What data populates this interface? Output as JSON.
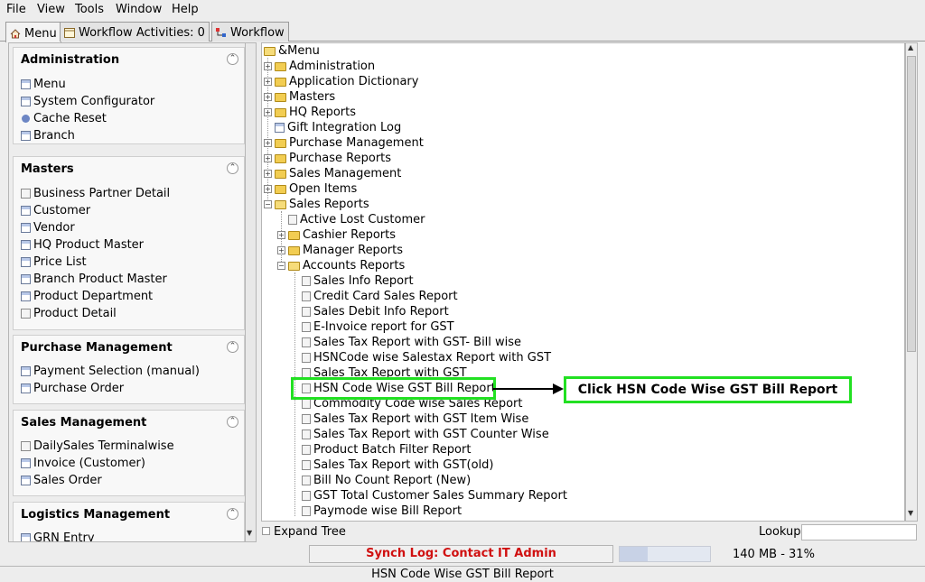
{
  "menubar": {
    "file": "File",
    "view": "View",
    "tools": "Tools",
    "window": "Window",
    "help": "Help"
  },
  "tabs": [
    {
      "label": "Menu",
      "icon": "home-icon"
    },
    {
      "label": "Workflow Activities: 0",
      "icon": "calendar-icon"
    },
    {
      "label": "Workflow",
      "icon": "workflow-icon"
    }
  ],
  "sidebar": {
    "administration": {
      "title": "Administration",
      "items": [
        "Menu",
        "System Configurator",
        "Cache Reset",
        "Branch"
      ]
    },
    "masters": {
      "title": "Masters",
      "items": [
        "Business Partner Detail",
        "Customer",
        "Vendor",
        "HQ Product Master",
        "Price List",
        "Branch Product Master",
        "Product Department",
        "Product Detail"
      ]
    },
    "purchase": {
      "title": "Purchase Management",
      "items": [
        "Payment Selection (manual)",
        "Purchase Order"
      ]
    },
    "sales": {
      "title": "Sales Management",
      "items": [
        "DailySales Terminalwise",
        "Invoice (Customer)",
        "Sales Order"
      ]
    },
    "logistics": {
      "title": "Logistics Management",
      "items": [
        "GRN Entry"
      ]
    }
  },
  "tree": {
    "root": "&Menu",
    "top": [
      "Administration",
      "Application Dictionary",
      "Masters",
      "HQ Reports",
      "Gift Integration Log",
      "Purchase Management",
      "Purchase Reports",
      "Sales Management",
      "Open Items",
      "Sales Reports"
    ],
    "sales_reports": [
      "Active Lost Customer",
      "Cashier Reports",
      "Manager Reports",
      "Accounts Reports"
    ],
    "accounts_reports": [
      "Sales Info Report",
      "Credit Card Sales Report",
      "Sales Debit Info Report",
      "E-Invoice report for GST",
      "Sales Tax Report with GST- Bill wise",
      "HSNCode wise Salestax Report with GST",
      "Sales Tax Report with GST",
      "HSN Code Wise GST Bill Report",
      "Commodity Code wise Sales Report",
      "Sales Tax Report with GST Item Wise",
      "Sales Tax Report with GST Counter Wise",
      "Product Batch Filter Report",
      "Sales Tax Report with GST(old)",
      "Bill No Count Report (New)",
      "GST Total Customer Sales Summary Report",
      "Paymode wise Bill Report"
    ]
  },
  "annotation": {
    "callout": "Click HSN Code Wise GST Bill Report",
    "color": "#22e022"
  },
  "bottom": {
    "expand_tree": "Expand Tree",
    "lookup": "Lookup"
  },
  "status": {
    "synch": "Synch Log: Contact IT Admin",
    "memory": "140 MB - 31%",
    "memory_fraction": 0.31,
    "statusline": "HSN Code Wise GST Bill Report"
  }
}
